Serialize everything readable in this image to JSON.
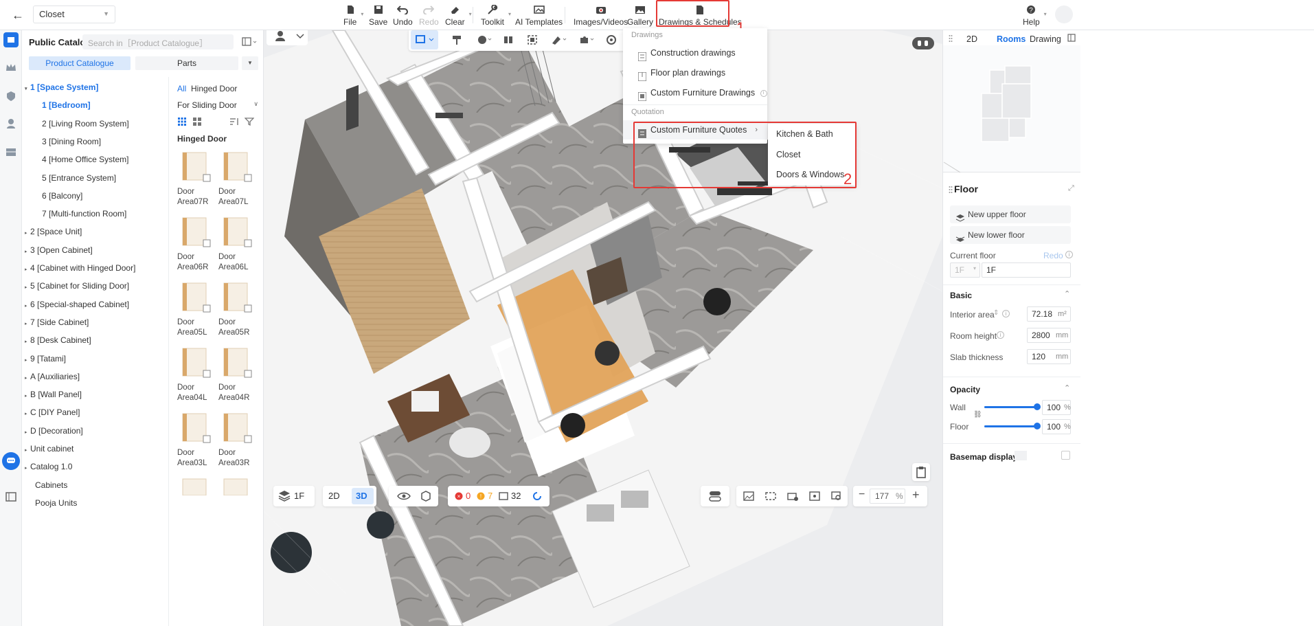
{
  "topbar": {
    "project": "Closet",
    "tools": [
      {
        "label": "File"
      },
      {
        "label": "Save"
      },
      {
        "label": "Undo"
      },
      {
        "label": "Redo"
      },
      {
        "label": "Clear"
      },
      {
        "label": "Toolkit"
      },
      {
        "label": "AI Templates"
      },
      {
        "label": "Images/Videos"
      },
      {
        "label": "Gallery"
      },
      {
        "label": "Drawings & Schedules"
      },
      {
        "label": "Help"
      }
    ],
    "annotation_1": "1",
    "annotation_2": "2"
  },
  "catalog": {
    "title": "Public Catalog",
    "search_placeholder": "Search in［Product Catalogue］",
    "tab_product": "Product Catalogue",
    "tab_parts": "Parts",
    "tree": [
      {
        "label": "1 [Space System]",
        "arrow": "▾",
        "selected": true
      },
      {
        "label": "1 [Bedroom]",
        "arrow": "",
        "selected": true
      },
      {
        "label": "2 [Living Room System]",
        "arrow": ""
      },
      {
        "label": "3 [Dining Room]",
        "arrow": ""
      },
      {
        "label": "4 [Home Office System]",
        "arrow": ""
      },
      {
        "label": "5 [Entrance System]",
        "arrow": ""
      },
      {
        "label": "6 [Balcony]",
        "arrow": ""
      },
      {
        "label": "7 [Multi-function Room]",
        "arrow": ""
      },
      {
        "label": "2 [Space Unit]",
        "arrow": "▸"
      },
      {
        "label": "3 [Open Cabinet]",
        "arrow": "▸"
      },
      {
        "label": "4 [Cabinet with Hinged Door]",
        "arrow": "▸"
      },
      {
        "label": "5 [Cabinet for Sliding Door]",
        "arrow": "▸"
      },
      {
        "label": "6 [Special-shaped Cabinet]",
        "arrow": "▸"
      },
      {
        "label": "7 [Side Cabinet]",
        "arrow": "▸"
      },
      {
        "label": "8 [Desk Cabinet]",
        "arrow": "▸"
      },
      {
        "label": "9 [Tatami]",
        "arrow": "▸"
      },
      {
        "label": "A [Auxiliaries]",
        "arrow": "▸"
      },
      {
        "label": "B [Wall Panel]",
        "arrow": "▸"
      },
      {
        "label": "C [DIY Panel]",
        "arrow": "▸"
      },
      {
        "label": "D [Decoration]",
        "arrow": "▸"
      },
      {
        "label": "Unit cabinet",
        "arrow": "▸"
      },
      {
        "label": "Catalog 1.0",
        "arrow": "▸"
      },
      {
        "label": "Cabinets",
        "arrow": ""
      },
      {
        "label": "Pooja Units",
        "arrow": ""
      }
    ],
    "filter_all": "All",
    "filter_hinged": "Hinged Door",
    "filter_sliding": "For Sliding Door",
    "group_title": "Hinged Door",
    "products": [
      {
        "line1": "Door",
        "line2": "Area07R"
      },
      {
        "line1": "Door",
        "line2": "Area07L"
      },
      {
        "line1": "Door",
        "line2": "Area06R"
      },
      {
        "line1": "Door",
        "line2": "Area06L"
      },
      {
        "line1": "Door",
        "line2": "Area05L"
      },
      {
        "line1": "Door",
        "line2": "Area05R"
      },
      {
        "line1": "Door",
        "line2": "Area04L"
      },
      {
        "line1": "Door",
        "line2": "Area04R"
      },
      {
        "line1": "Door",
        "line2": "Area03L"
      },
      {
        "line1": "Door",
        "line2": "Area03R"
      }
    ]
  },
  "dropdown": {
    "section_drawings": "Drawings",
    "construction": "Construction drawings",
    "floor_plan": "Floor plan drawings",
    "custom_drawings": "Custom Furniture Drawings",
    "section_quotation": "Quotation",
    "custom_quotes": "Custom Furniture Quotes",
    "submenu": [
      "Kitchen & Bath",
      "Closet",
      "Doors & Windows"
    ]
  },
  "bottom": {
    "floor": "1F",
    "view2d": "2D",
    "view3d": "3D",
    "errors": "0",
    "warnings": "7",
    "count": "32",
    "zoom": "177",
    "zoom_unit": "%"
  },
  "right": {
    "tab_2d": "2D",
    "tab_rooms": "Rooms",
    "tab_drawing": "Drawing",
    "floor_title": "Floor",
    "new_upper": "New upper floor",
    "new_lower": "New lower floor",
    "current_floor_label": "Current floor",
    "redo": "Redo",
    "floor_code": "1F",
    "floor_name": "1F",
    "basic": "Basic",
    "interior_area_label": "Interior area",
    "interior_area": "72.18",
    "area_unit": "m²",
    "room_height_label": "Room height",
    "room_height": "2800",
    "slab_label": "Slab thickness",
    "slab": "120",
    "mm": "mm",
    "opacity": "Opacity",
    "wall_label": "Wall",
    "wall_value": "100",
    "floor_label": "Floor",
    "floor_value": "100",
    "pct": "%",
    "basemap": "Basemap display",
    "wall_opacity": 1.0,
    "floor_opacity": 1.0
  },
  "colors": {
    "accent": "#1f73e6",
    "annotation": "#e53935"
  }
}
